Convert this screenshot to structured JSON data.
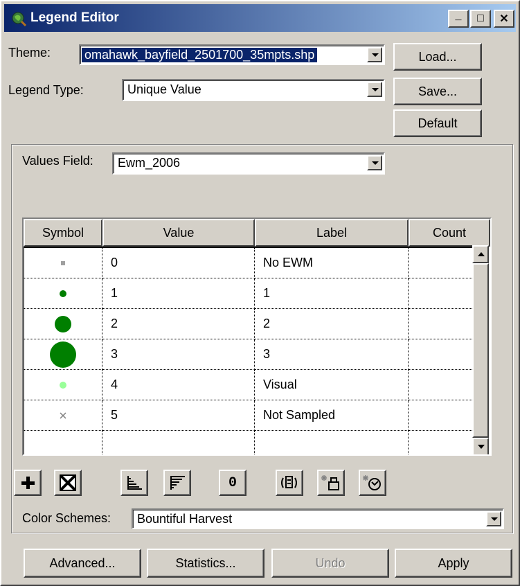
{
  "window": {
    "title": "Legend Editor",
    "minimize_label": "_",
    "maximize_label": "□",
    "close_label": "✕"
  },
  "theme": {
    "label": "Theme:",
    "value": "omahawk_bayfield_2501700_35mpts.shp"
  },
  "legend_type": {
    "label": "Legend Type:",
    "value": "Unique Value"
  },
  "buttons": {
    "load": "Load...",
    "save": "Save...",
    "default": "Default"
  },
  "values_field": {
    "label": "Values Field:",
    "value": "Ewm_2006"
  },
  "table": {
    "columns": [
      "Symbol",
      "Value",
      "Label",
      "Count"
    ],
    "rows": [
      {
        "symbol": "small-square-gray",
        "value": "0",
        "label": "No EWM",
        "count": ""
      },
      {
        "symbol": "dot-small-green",
        "value": "1",
        "label": "1",
        "count": ""
      },
      {
        "symbol": "dot-medium-green",
        "value": "2",
        "label": "2",
        "count": ""
      },
      {
        "symbol": "dot-large-green",
        "value": "3",
        "label": "3",
        "count": ""
      },
      {
        "symbol": "dot-small-lightgreen",
        "value": "4",
        "label": "Visual",
        "count": ""
      },
      {
        "symbol": "x-mark-gray",
        "value": "5",
        "label": "Not Sampled",
        "count": ""
      },
      {
        "symbol": "",
        "value": "",
        "label": "",
        "count": ""
      }
    ]
  },
  "toolbar": {
    "icons": [
      "add-icon",
      "delete-icon",
      "sort-ascending-icon",
      "sort-descending-icon",
      "null-value-icon",
      "statistics-icon",
      "scale-symbols-icon",
      "refresh-icon"
    ],
    "null_label": "0"
  },
  "color_schemes": {
    "label": "Color Schemes:",
    "value": "Bountiful Harvest"
  },
  "bottom_buttons": {
    "advanced": "Advanced...",
    "statistics": "Statistics...",
    "undo": "Undo",
    "apply": "Apply"
  },
  "colors": {
    "title_gradient_start": "#0a246a",
    "title_gradient_end": "#a6caf0",
    "dark_green": "#007f00",
    "light_green": "#99ff99",
    "gray": "#a0a0a0"
  }
}
